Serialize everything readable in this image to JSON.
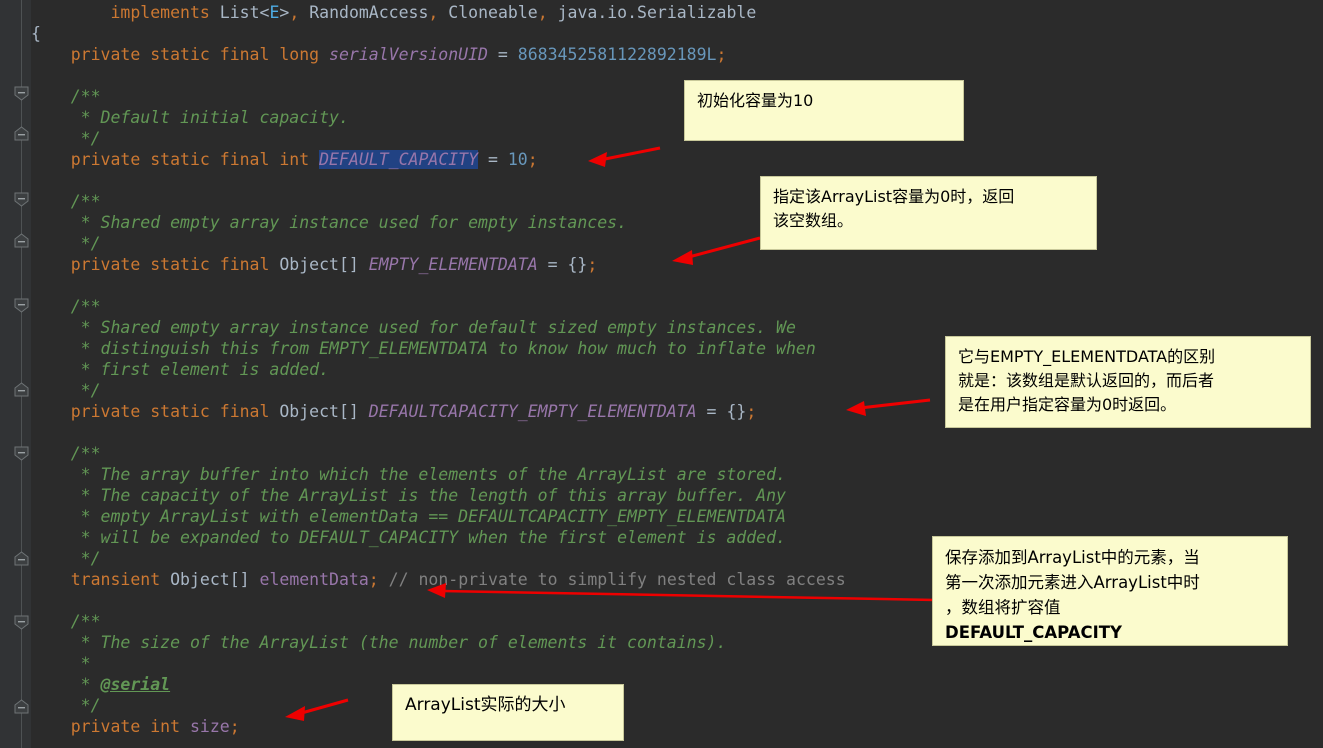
{
  "editor": {
    "theme_background": "#2b2b2b",
    "gutter_background": "#313335",
    "current_line_background": "#323232",
    "selection_background": "#214283",
    "arrow_color": "#ee0000",
    "note_background": "#fbfbcd"
  },
  "code": {
    "lines": [
      {
        "indent": 0,
        "text": "        implements List<E>, RandomAccess, Cloneable, java.io.Serializable"
      },
      {
        "indent": 0,
        "text": "{"
      },
      {
        "indent": 0,
        "text": ""
      },
      {
        "indent": 0,
        "text": "    private static final long serialVersionUID = 8683452581122892189L;"
      },
      {
        "indent": 0,
        "text": ""
      },
      {
        "indent": 0,
        "text": "    /**"
      },
      {
        "indent": 0,
        "text": "     * Default initial capacity."
      },
      {
        "indent": 0,
        "text": "     */"
      },
      {
        "indent": 0,
        "text": "    private static final int DEFAULT_CAPACITY = 10;"
      },
      {
        "indent": 0,
        "text": ""
      },
      {
        "indent": 0,
        "text": "    /**"
      },
      {
        "indent": 0,
        "text": "     * Shared empty array instance used for empty instances."
      },
      {
        "indent": 0,
        "text": "     */"
      },
      {
        "indent": 0,
        "text": "    private static final Object[] EMPTY_ELEMENTDATA = {};"
      },
      {
        "indent": 0,
        "text": ""
      },
      {
        "indent": 0,
        "text": "    /**"
      },
      {
        "indent": 0,
        "text": "     * Shared empty array instance used for default sized empty instances. We"
      },
      {
        "indent": 0,
        "text": "     * distinguish this from EMPTY_ELEMENTDATA to know how much to inflate when"
      },
      {
        "indent": 0,
        "text": "     * first element is added."
      },
      {
        "indent": 0,
        "text": "     */"
      },
      {
        "indent": 0,
        "text": "    private static final Object[] DEFAULTCAPACITY_EMPTY_ELEMENTDATA = {};"
      },
      {
        "indent": 0,
        "text": ""
      },
      {
        "indent": 0,
        "text": "    /**"
      },
      {
        "indent": 0,
        "text": "     * The array buffer into which the elements of the ArrayList are stored."
      },
      {
        "indent": 0,
        "text": "     * The capacity of the ArrayList is the length of this array buffer. Any"
      },
      {
        "indent": 0,
        "text": "     * empty ArrayList with elementData == DEFAULTCAPACITY_EMPTY_ELEMENTDATA"
      },
      {
        "indent": 0,
        "text": "     * will be expanded to DEFAULT_CAPACITY when the first element is added."
      },
      {
        "indent": 0,
        "text": "     */"
      },
      {
        "indent": 0,
        "text": "    transient Object[] elementData; // non-private to simplify nested class access"
      },
      {
        "indent": 0,
        "text": ""
      },
      {
        "indent": 0,
        "text": "    /**"
      },
      {
        "indent": 0,
        "text": "     * The size of the ArrayList (the number of elements it contains)."
      },
      {
        "indent": 0,
        "text": "     *"
      },
      {
        "indent": 0,
        "text": "     * @serial"
      },
      {
        "indent": 0,
        "text": "     */"
      },
      {
        "indent": 0,
        "text": "    private int size;"
      }
    ],
    "selected_token": "DEFAULT_CAPACITY",
    "keywords": [
      "implements",
      "private",
      "static",
      "final",
      "long",
      "int",
      "transient"
    ],
    "types": [
      "List",
      "RandomAccess",
      "Cloneable",
      "java.io.Serializable",
      "Object"
    ],
    "fields": [
      "serialVersionUID",
      "DEFAULT_CAPACITY",
      "EMPTY_ELEMENTDATA",
      "DEFAULTCAPACITY_EMPTY_ELEMENTDATA",
      "elementData",
      "size"
    ],
    "literals": [
      "8683452581122892189L",
      "10"
    ],
    "javadoc_tag": "@serial",
    "trailing_comment": "// non-private to simplify nested class access"
  },
  "annotations": [
    {
      "id": "note-default-capacity",
      "lines": [
        "初始化容量为10"
      ],
      "target": "DEFAULT_CAPACITY = 10;"
    },
    {
      "id": "note-empty-elementdata",
      "lines": [
        "指定该ArrayList容量为0时，返回",
        "该空数组。"
      ],
      "target": "EMPTY_ELEMENTDATA = {};"
    },
    {
      "id": "note-defaultcapacity-empty-elementdata",
      "lines": [
        "它与EMPTY_ELEMENTDATA的区别",
        "就是：该数组是默认返回的，而后者",
        "是在用户指定容量为0时返回。"
      ],
      "target": "DEFAULTCAPACITY_EMPTY_ELEMENTDATA = {};"
    },
    {
      "id": "note-element-data",
      "lines": [
        "保存添加到ArrayList中的元素，当",
        "第一次添加元素进入ArrayList中时",
        "，数组将扩容值",
        "DEFAULT_CAPACITY"
      ],
      "target": "transient Object[] elementData;"
    },
    {
      "id": "note-size",
      "lines": [
        "ArrayList实际的大小"
      ],
      "target": "private int size;"
    }
  ],
  "icons": {
    "fold_collapse": "fold-minus-icon",
    "fold_end": "fold-end-icon",
    "arrow": "arrow-pointer-icon"
  }
}
